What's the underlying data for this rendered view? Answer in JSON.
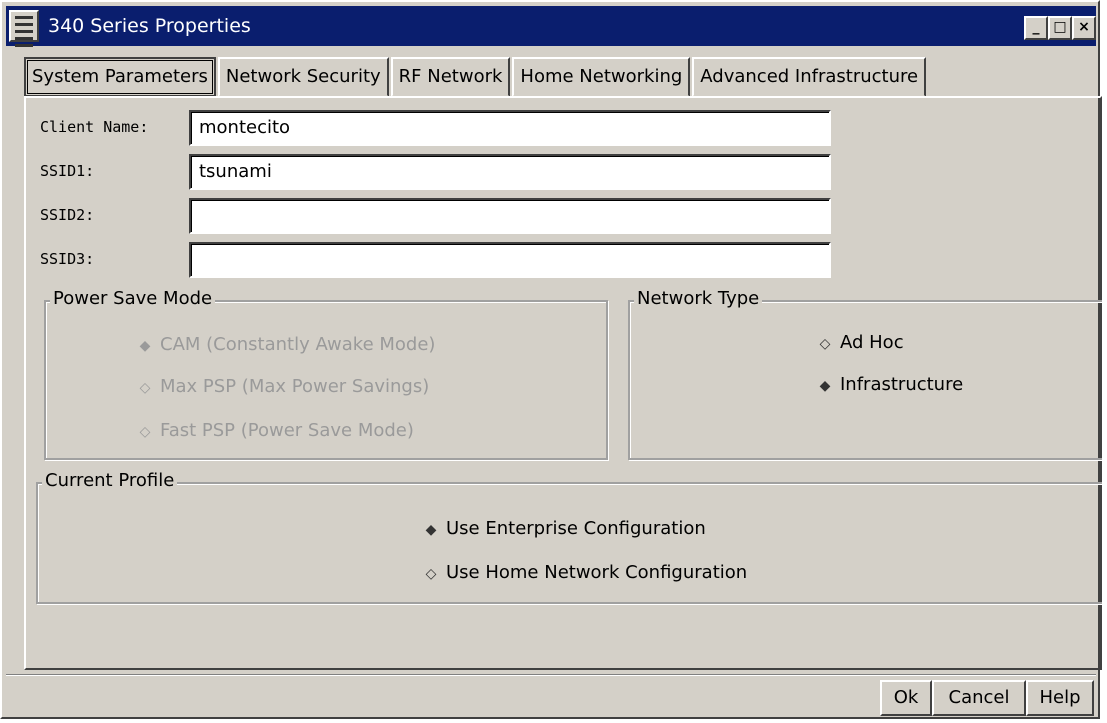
{
  "window": {
    "title": "340 Series Properties"
  },
  "tabs": [
    {
      "label": "System Parameters",
      "active": true
    },
    {
      "label": "Network Security",
      "active": false
    },
    {
      "label": "RF Network",
      "active": false
    },
    {
      "label": "Home Networking",
      "active": false
    },
    {
      "label": "Advanced Infrastructure",
      "active": false
    }
  ],
  "fields": {
    "client_name": {
      "label": "Client Name:",
      "value": "montecito"
    },
    "ssid1": {
      "label": "SSID1:",
      "value": "tsunami"
    },
    "ssid2": {
      "label": "SSID2:",
      "value": ""
    },
    "ssid3": {
      "label": "SSID3:",
      "value": ""
    }
  },
  "power_save": {
    "legend": "Power Save Mode",
    "enabled": false,
    "options": [
      {
        "label": "CAM (Constantly Awake Mode)",
        "selected": true
      },
      {
        "label": "Max PSP (Max Power Savings)",
        "selected": false
      },
      {
        "label": "Fast PSP (Power Save Mode)",
        "selected": false
      }
    ]
  },
  "network_type": {
    "legend": "Network Type",
    "options": [
      {
        "label": "Ad Hoc",
        "selected": false
      },
      {
        "label": "Infrastructure",
        "selected": true
      }
    ]
  },
  "current_profile": {
    "legend": "Current Profile",
    "options": [
      {
        "label": "Use Enterprise Configuration",
        "selected": true
      },
      {
        "label": "Use Home Network Configuration",
        "selected": false
      }
    ]
  },
  "buttons": {
    "ok": "Ok",
    "cancel": "Cancel",
    "help": "Help"
  },
  "icons": {
    "window_menu": "window-menu-icon",
    "minimize": "minimize-icon",
    "maximize": "maximize-icon",
    "close": "close-icon",
    "radio_selected": "radio-selected-icon",
    "radio_unselected": "radio-unselected-icon"
  },
  "colors": {
    "titlebar": "#0a1e6e",
    "window_bg": "#d4d0c8",
    "disabled_text": "#9a9a9a"
  }
}
